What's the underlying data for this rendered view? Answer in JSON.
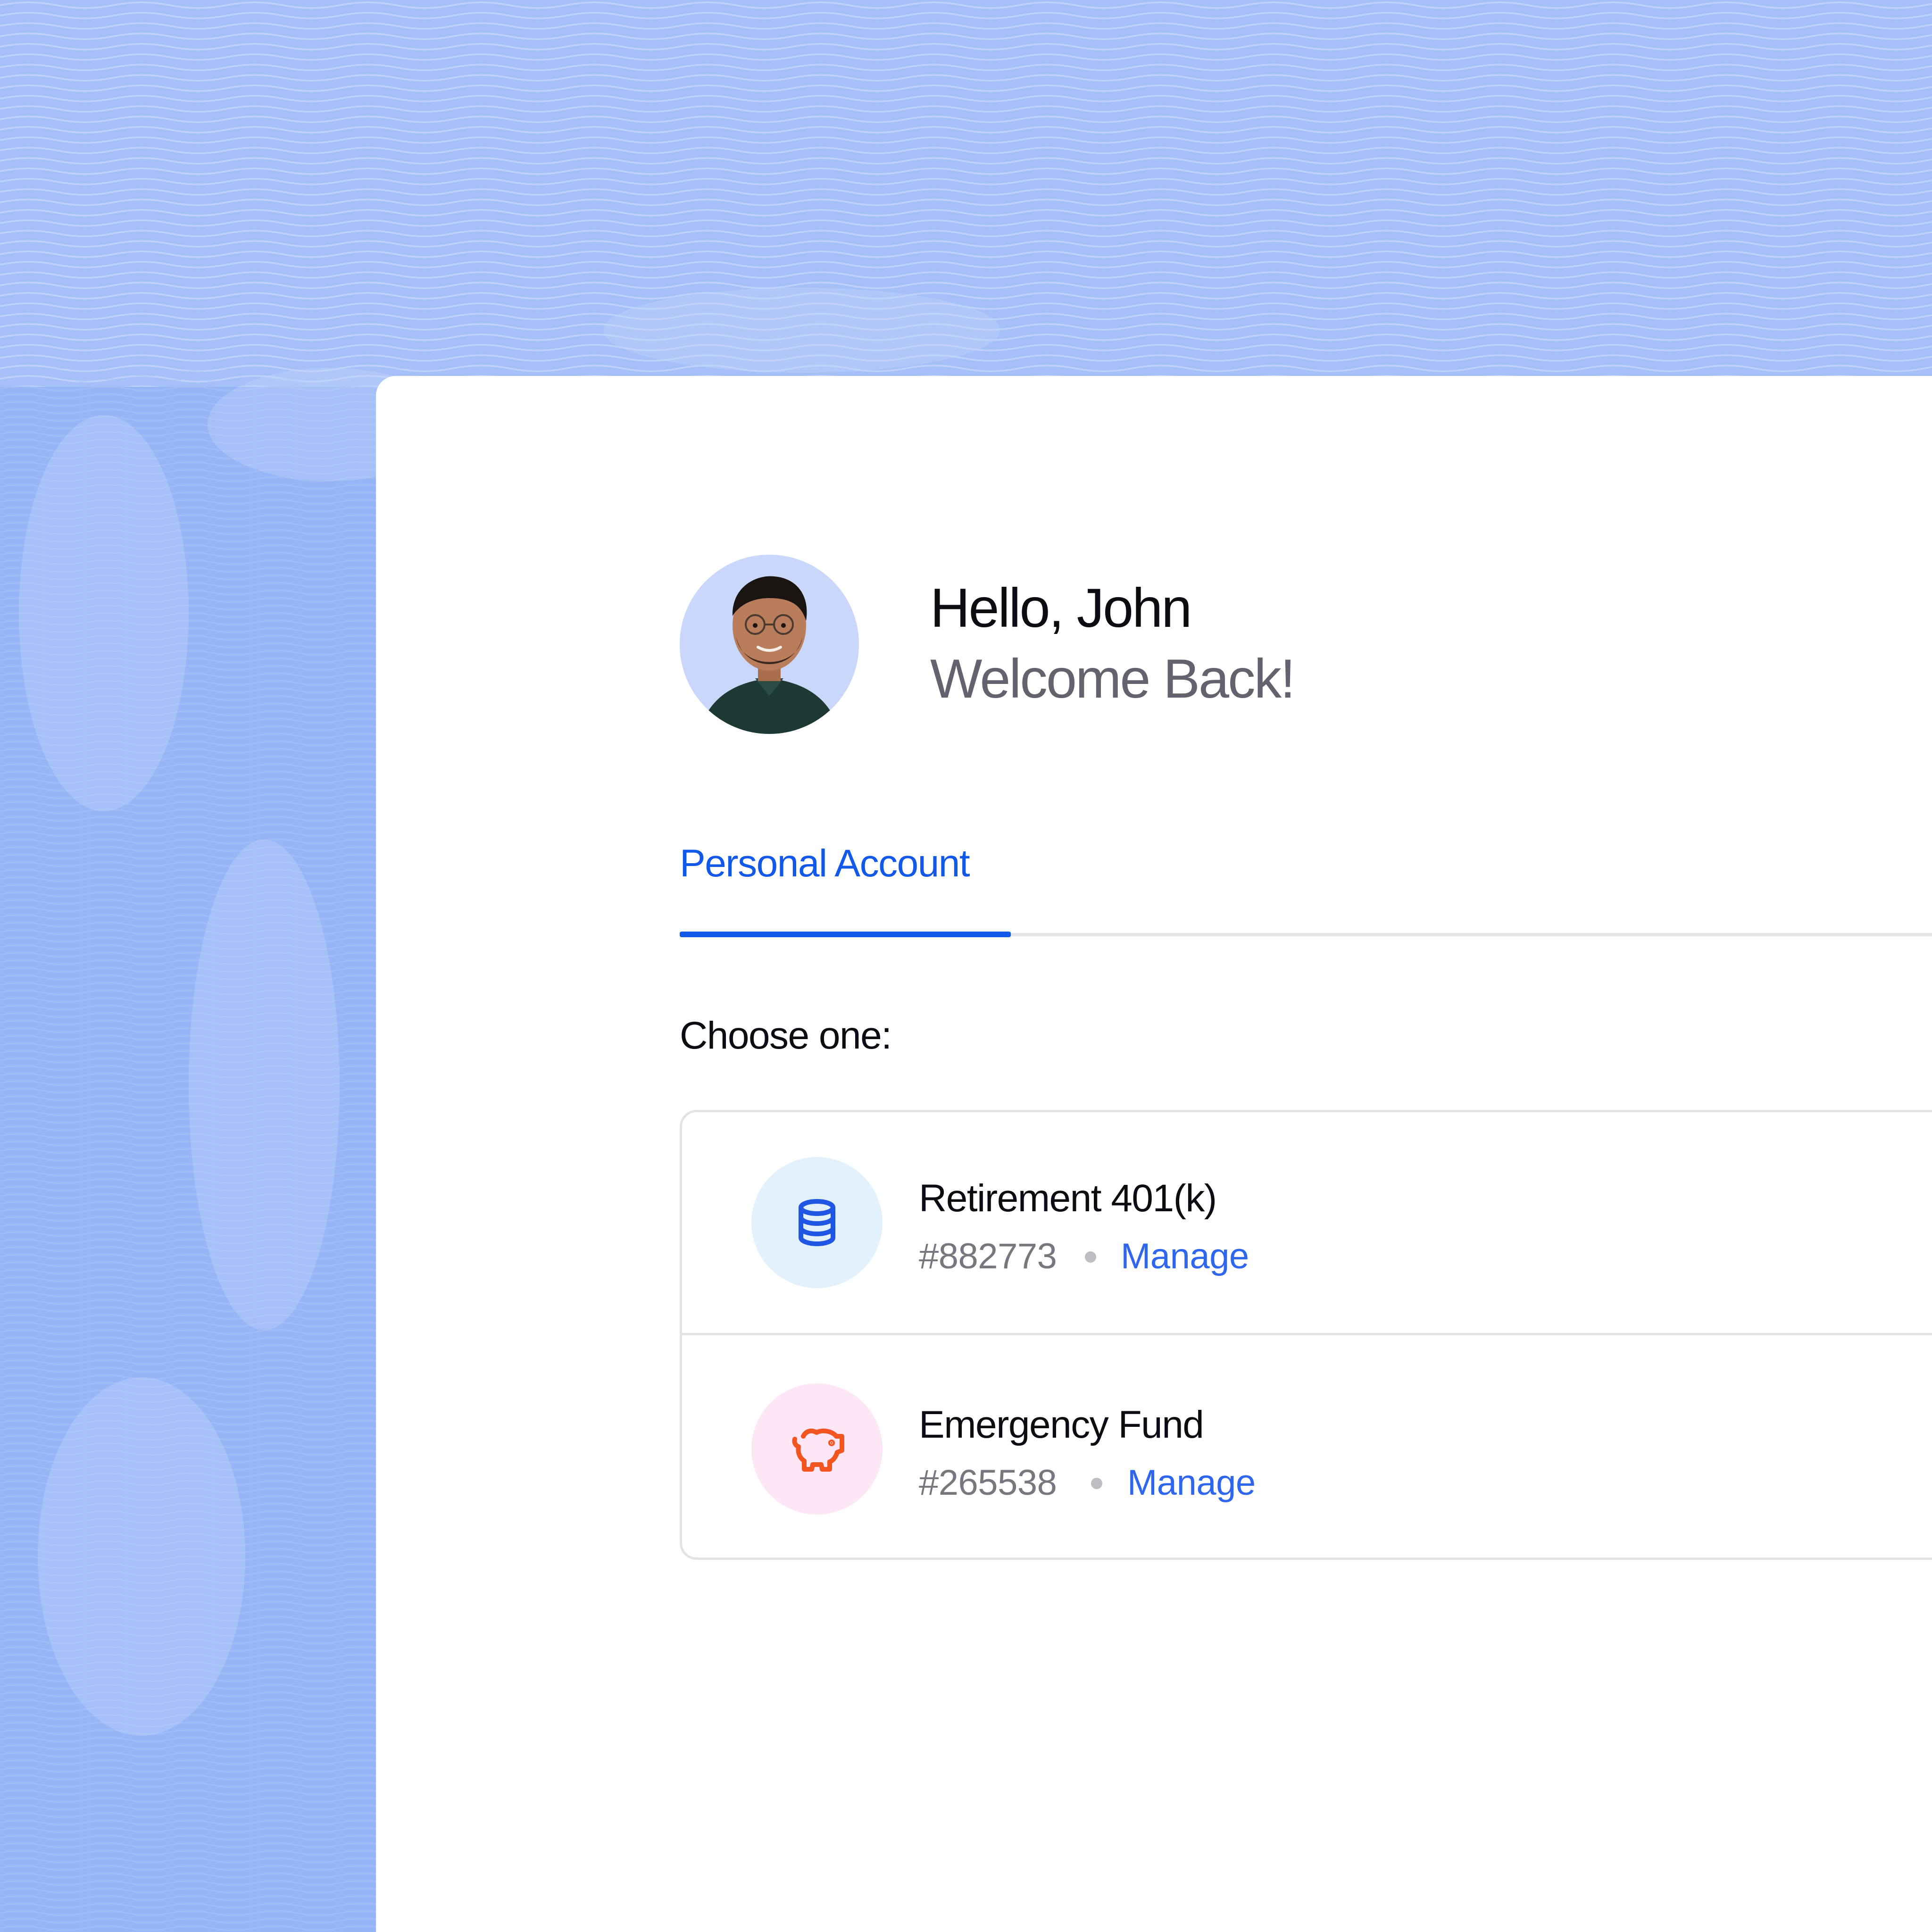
{
  "colors": {
    "background": "#93b2f5",
    "card": "#ffffff",
    "accent": "#1259ea",
    "link": "#2e66ee",
    "retirement_icon_bg": "#e2f1fc",
    "retirement_icon": "#1f57e4",
    "emergency_icon_bg": "#fde7f7",
    "emergency_icon": "#f2551f"
  },
  "header": {
    "greeting": "Hello, John",
    "subtitle": "Welcome Back!",
    "avatar_icon": "user-avatar-photo"
  },
  "tabs": [
    {
      "label": "Personal Account",
      "active": true
    }
  ],
  "prompt": "Choose one:",
  "accounts": [
    {
      "name": "Retirement 401(k)",
      "number": "#882773",
      "action": "Manage",
      "icon": "coin-stack-icon"
    },
    {
      "name": "Emergency Fund",
      "number": "#265538",
      "action": "Manage",
      "icon": "piggy-bank-icon"
    }
  ]
}
